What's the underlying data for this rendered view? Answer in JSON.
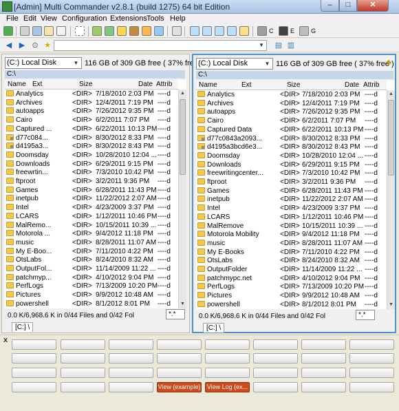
{
  "window": {
    "title": "[Admin] Multi Commander v2.8.1 (build 1275) 64 bit Edition",
    "min": "–",
    "max": "□",
    "close": "✕"
  },
  "menu": [
    "File",
    "Edit",
    "View",
    "Configuration",
    "Extensions",
    "Tools",
    "Help"
  ],
  "toolbar": {
    "drive_labels": [
      "C",
      "E",
      "G"
    ]
  },
  "address": {
    "value": ""
  },
  "left": {
    "drive": "(C:) Local Disk",
    "free": "116 GB of 309 GB free ( 37% free )",
    "path": "C:\\",
    "columns": {
      "name": "Name",
      "ext": "Ext",
      "size": "Size",
      "date": "Date",
      "attrib": "Attrib"
    },
    "rows": [
      [
        "Analytics",
        "<DIR>",
        "7/18/2010 2:03 PM",
        "----d"
      ],
      [
        "Archives",
        "<DIR>",
        "12/4/2011 7:19 PM",
        "----d"
      ],
      [
        "autoapps",
        "<DIR>",
        "7/26/2012 9:35 PM",
        "----d"
      ],
      [
        "Cairo",
        "<DIR>",
        "6/2/2011 7:07 PM",
        "----d"
      ],
      [
        "Captured ...",
        "<DIR>",
        "6/22/2011 10:13 PM",
        "----d"
      ],
      [
        "d77c084...",
        "<DIR>",
        "8/30/2012 8:33 PM",
        "----d"
      ],
      [
        "d4195a3...",
        "<DIR>",
        "8/30/2012 8:43 PM",
        "----d"
      ],
      [
        "Doomsday",
        "<DIR>",
        "10/28/2010 12:04 ...",
        "----d"
      ],
      [
        "Downloads",
        "<DIR>",
        "6/29/2011 9:15 PM",
        "----d"
      ],
      [
        "freewrtin...",
        "<DIR>",
        "7/3/2010 10:42 PM",
        "----d"
      ],
      [
        "ftproot",
        "<DIR>",
        "3/2/2011 9:36 PM",
        "----d"
      ],
      [
        "Games",
        "<DIR>",
        "6/28/2011 11:43 PM",
        "----d"
      ],
      [
        "inetpub",
        "<DIR>",
        "11/22/2012 2:07 AM",
        "----d"
      ],
      [
        "Intel",
        "<DIR>",
        "4/23/2009 3:37 PM",
        "----d"
      ],
      [
        "LCARS",
        "<DIR>",
        "1/12/2011 10:46 PM",
        "----d"
      ],
      [
        "MalRemo...",
        "<DIR>",
        "10/15/2011 10:39 ...",
        "----d"
      ],
      [
        "Motorola ...",
        "<DIR>",
        "9/4/2012 11:18 PM",
        "----d"
      ],
      [
        "music",
        "<DIR>",
        "8/28/2011 11:07 AM",
        "----d"
      ],
      [
        "My E-Boo...",
        "<DIR>",
        "7/11/2010 4:22 PM",
        "----d"
      ],
      [
        "OtsLabs",
        "<DIR>",
        "8/24/2010 8:32 AM",
        "----d"
      ],
      [
        "OutputFol...",
        "<DIR>",
        "11/14/2009 11:22 ...",
        "----d"
      ],
      [
        "patchmyp...",
        "<DIR>",
        "4/10/2012 9:04 PM",
        "----d"
      ],
      [
        "PerfLogs",
        "<DIR>",
        "7/13/2009 10:20 PM",
        "----d"
      ],
      [
        "Pictures",
        "<DIR>",
        "9/9/2012 10:48 AM",
        "----d"
      ],
      [
        "powershell",
        "<DIR>",
        "8/1/2012 8:01 PM",
        "----d"
      ]
    ],
    "status": "0.0 K/6,968.6 K in 0/44 Files and 0/42 Fol",
    "filter": "*.*",
    "tab": "[C:] \\"
  },
  "right": {
    "drive": "(C:) Local Disk",
    "free": "116 GB of 309 GB free ( 37% free )",
    "path": "C:\\",
    "columns": {
      "name": "Name",
      "ext": "Ext",
      "size": "Size",
      "date": "Date",
      "attrib": "Attrib"
    },
    "rows": [
      [
        "Analytics",
        "<DIR>",
        "7/18/2010 2:03 PM",
        "----d"
      ],
      [
        "Archives",
        "<DIR>",
        "12/4/2011 7:19 PM",
        "----d"
      ],
      [
        "autoapps",
        "<DIR>",
        "7/26/2012 9:35 PM",
        "----d"
      ],
      [
        "Cairo",
        "<DIR>",
        "6/2/2011 7:07 PM",
        "----d"
      ],
      [
        "Captured Data",
        "<DIR>",
        "6/22/2011 10:13 PM",
        "----d"
      ],
      [
        "d77c0843a2093...",
        "<DIR>",
        "8/30/2012 8:33 PM",
        "----d"
      ],
      [
        "d4195a3bcd6e3...",
        "<DIR>",
        "8/30/2012 8:43 PM",
        "----d"
      ],
      [
        "Doomsday",
        "<DIR>",
        "10/28/2010 12:04 ...",
        "----d"
      ],
      [
        "Downloads",
        "<DIR>",
        "6/29/2011 9:15 PM",
        "----d"
      ],
      [
        "freewritingcenter...",
        "<DIR>",
        "7/3/2010 10:42 PM",
        "----d"
      ],
      [
        "ftproot",
        "<DIR>",
        "3/2/2011 9:36 PM",
        "----d"
      ],
      [
        "Games",
        "<DIR>",
        "6/28/2011 11:43 PM",
        "----d"
      ],
      [
        "inetpub",
        "<DIR>",
        "11/22/2012 2:07 AM",
        "----d"
      ],
      [
        "Intel",
        "<DIR>",
        "4/23/2009 3:37 PM",
        "----d"
      ],
      [
        "LCARS",
        "<DIR>",
        "1/12/2011 10:46 PM",
        "----d"
      ],
      [
        "MalRemove",
        "<DIR>",
        "10/15/2011 10:39 ...",
        "----d"
      ],
      [
        "Motorola Mobility",
        "<DIR>",
        "9/4/2012 11:18 PM",
        "----d"
      ],
      [
        "music",
        "<DIR>",
        "8/28/2011 11:07 AM",
        "----d"
      ],
      [
        "My E-Books",
        "<DIR>",
        "7/11/2010 4:22 PM",
        "----d"
      ],
      [
        "OtsLabs",
        "<DIR>",
        "8/24/2010 8:32 AM",
        "----d"
      ],
      [
        "OutputFolder",
        "<DIR>",
        "11/14/2009 11:22 ...",
        "----d"
      ],
      [
        "patchmypc.net",
        "<DIR>",
        "4/10/2012 9:04 PM",
        "----d"
      ],
      [
        "PerfLogs",
        "<DIR>",
        "7/13/2009 10:20 PM",
        "----d"
      ],
      [
        "Pictures",
        "<DIR>",
        "9/9/2012 10:48 AM",
        "----d"
      ],
      [
        "powershell",
        "<DIR>",
        "8/1/2012 8:01 PM",
        "----d"
      ]
    ],
    "status": "0.0 K/6,968.6 K in 0/44 Files and 0/42 Fol",
    "filter": "*.*",
    "tab": "[C:] \\"
  },
  "buttons": {
    "close": "x",
    "view_example": "View (example)",
    "view_log": "View Log (ex..."
  },
  "colors": {
    "panel_path": "#c6d7ea",
    "active_border": "#4a90d9",
    "user_button_active": "#ce4a1c",
    "folder": "#f2c94c"
  }
}
